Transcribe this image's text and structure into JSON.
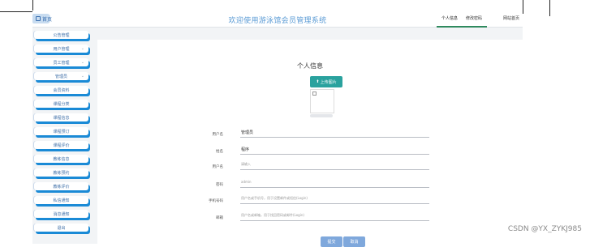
{
  "header": {
    "home_label": "首页",
    "site_title": "欢迎使用游泳馆会员管理系统",
    "tabs": [
      {
        "label": "个人信息"
      },
      {
        "label": "修改密码"
      },
      {
        "label": "网站首页"
      }
    ]
  },
  "sidebar": {
    "items": [
      {
        "label": "公告管理"
      },
      {
        "label": "用户管理"
      },
      {
        "label": "员工管理"
      },
      {
        "label": "管理员"
      },
      {
        "label": "会员资料"
      },
      {
        "label": "课程分类"
      },
      {
        "label": "课程信息"
      },
      {
        "label": "课程预订"
      },
      {
        "label": "课程评价"
      },
      {
        "label": "教练信息"
      },
      {
        "label": "教练预约"
      },
      {
        "label": "教练评价"
      },
      {
        "label": "私信通知"
      },
      {
        "label": "消息通知"
      },
      {
        "label": "退出"
      }
    ]
  },
  "profile": {
    "heading": "个人信息",
    "upload_label": "上传图片",
    "fields": [
      {
        "label": "用户名",
        "value": "管理员"
      },
      {
        "label": "姓名",
        "value": "程序"
      },
      {
        "label": "用户名",
        "value": "请输入"
      },
      {
        "label": "密码",
        "value": "admin"
      },
      {
        "label": "手机号码",
        "value": "用户名或手机号，用于设置邮件或短信(Login)"
      },
      {
        "label": "邮箱",
        "value": "用户名或邮箱，用于找回密码或邮件(Login)"
      }
    ],
    "submit_label": "提交",
    "cancel_label": "取消"
  },
  "watermark": "CSDN @YX_ZYKJ985",
  "colors": {
    "title": "#5b9bd5",
    "menu_accent": "#1a8ad6",
    "upload_btn": "#2aa29e",
    "action_btn": "#7fa8dc",
    "tab_underline": "#2f8a5e"
  },
  "icons": [
    "home-icon",
    "upload-icon",
    "broken-image-icon",
    "chevron-down-icon"
  ]
}
